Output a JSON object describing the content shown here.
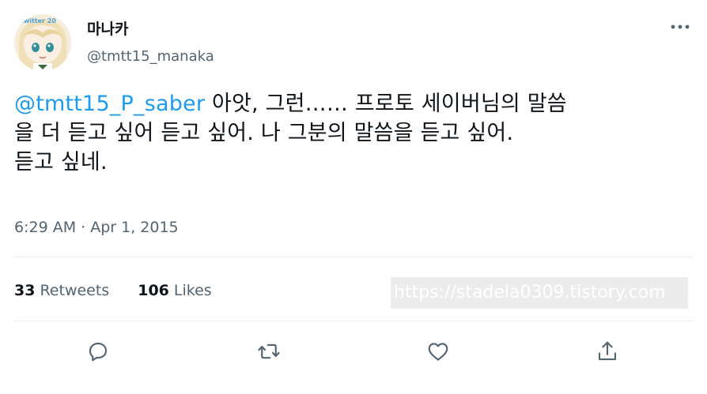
{
  "author": {
    "display_name": "마나카",
    "handle": "@tmtt15_manaka",
    "avatar_text": "twitter 20"
  },
  "tweet": {
    "mention": "@tmtt15_P_saber",
    "line1_rest": " 아앗, 그런…… 프로토 세이버님의 말씀",
    "line2": "을 더 듣고 싶어 듣고 싶어. 나 그분의 말씀을 듣고 싶어.",
    "line3": "듣고 싶네."
  },
  "timestamp": "6:29 AM · Apr 1, 2015",
  "stats": {
    "retweets_count": "33",
    "retweets_label": "Retweets",
    "likes_count": "106",
    "likes_label": "Likes"
  },
  "watermark": "https://stadela0309.tistory.com",
  "icons": {
    "more": "more-horizontal-icon",
    "reply": "reply-icon",
    "retweet": "retweet-icon",
    "like": "heart-icon",
    "share": "share-icon"
  },
  "colors": {
    "accent": "#1d9bf0",
    "secondary_text": "#536471",
    "primary_text": "#0f1419",
    "divider": "#e6ecf0"
  }
}
